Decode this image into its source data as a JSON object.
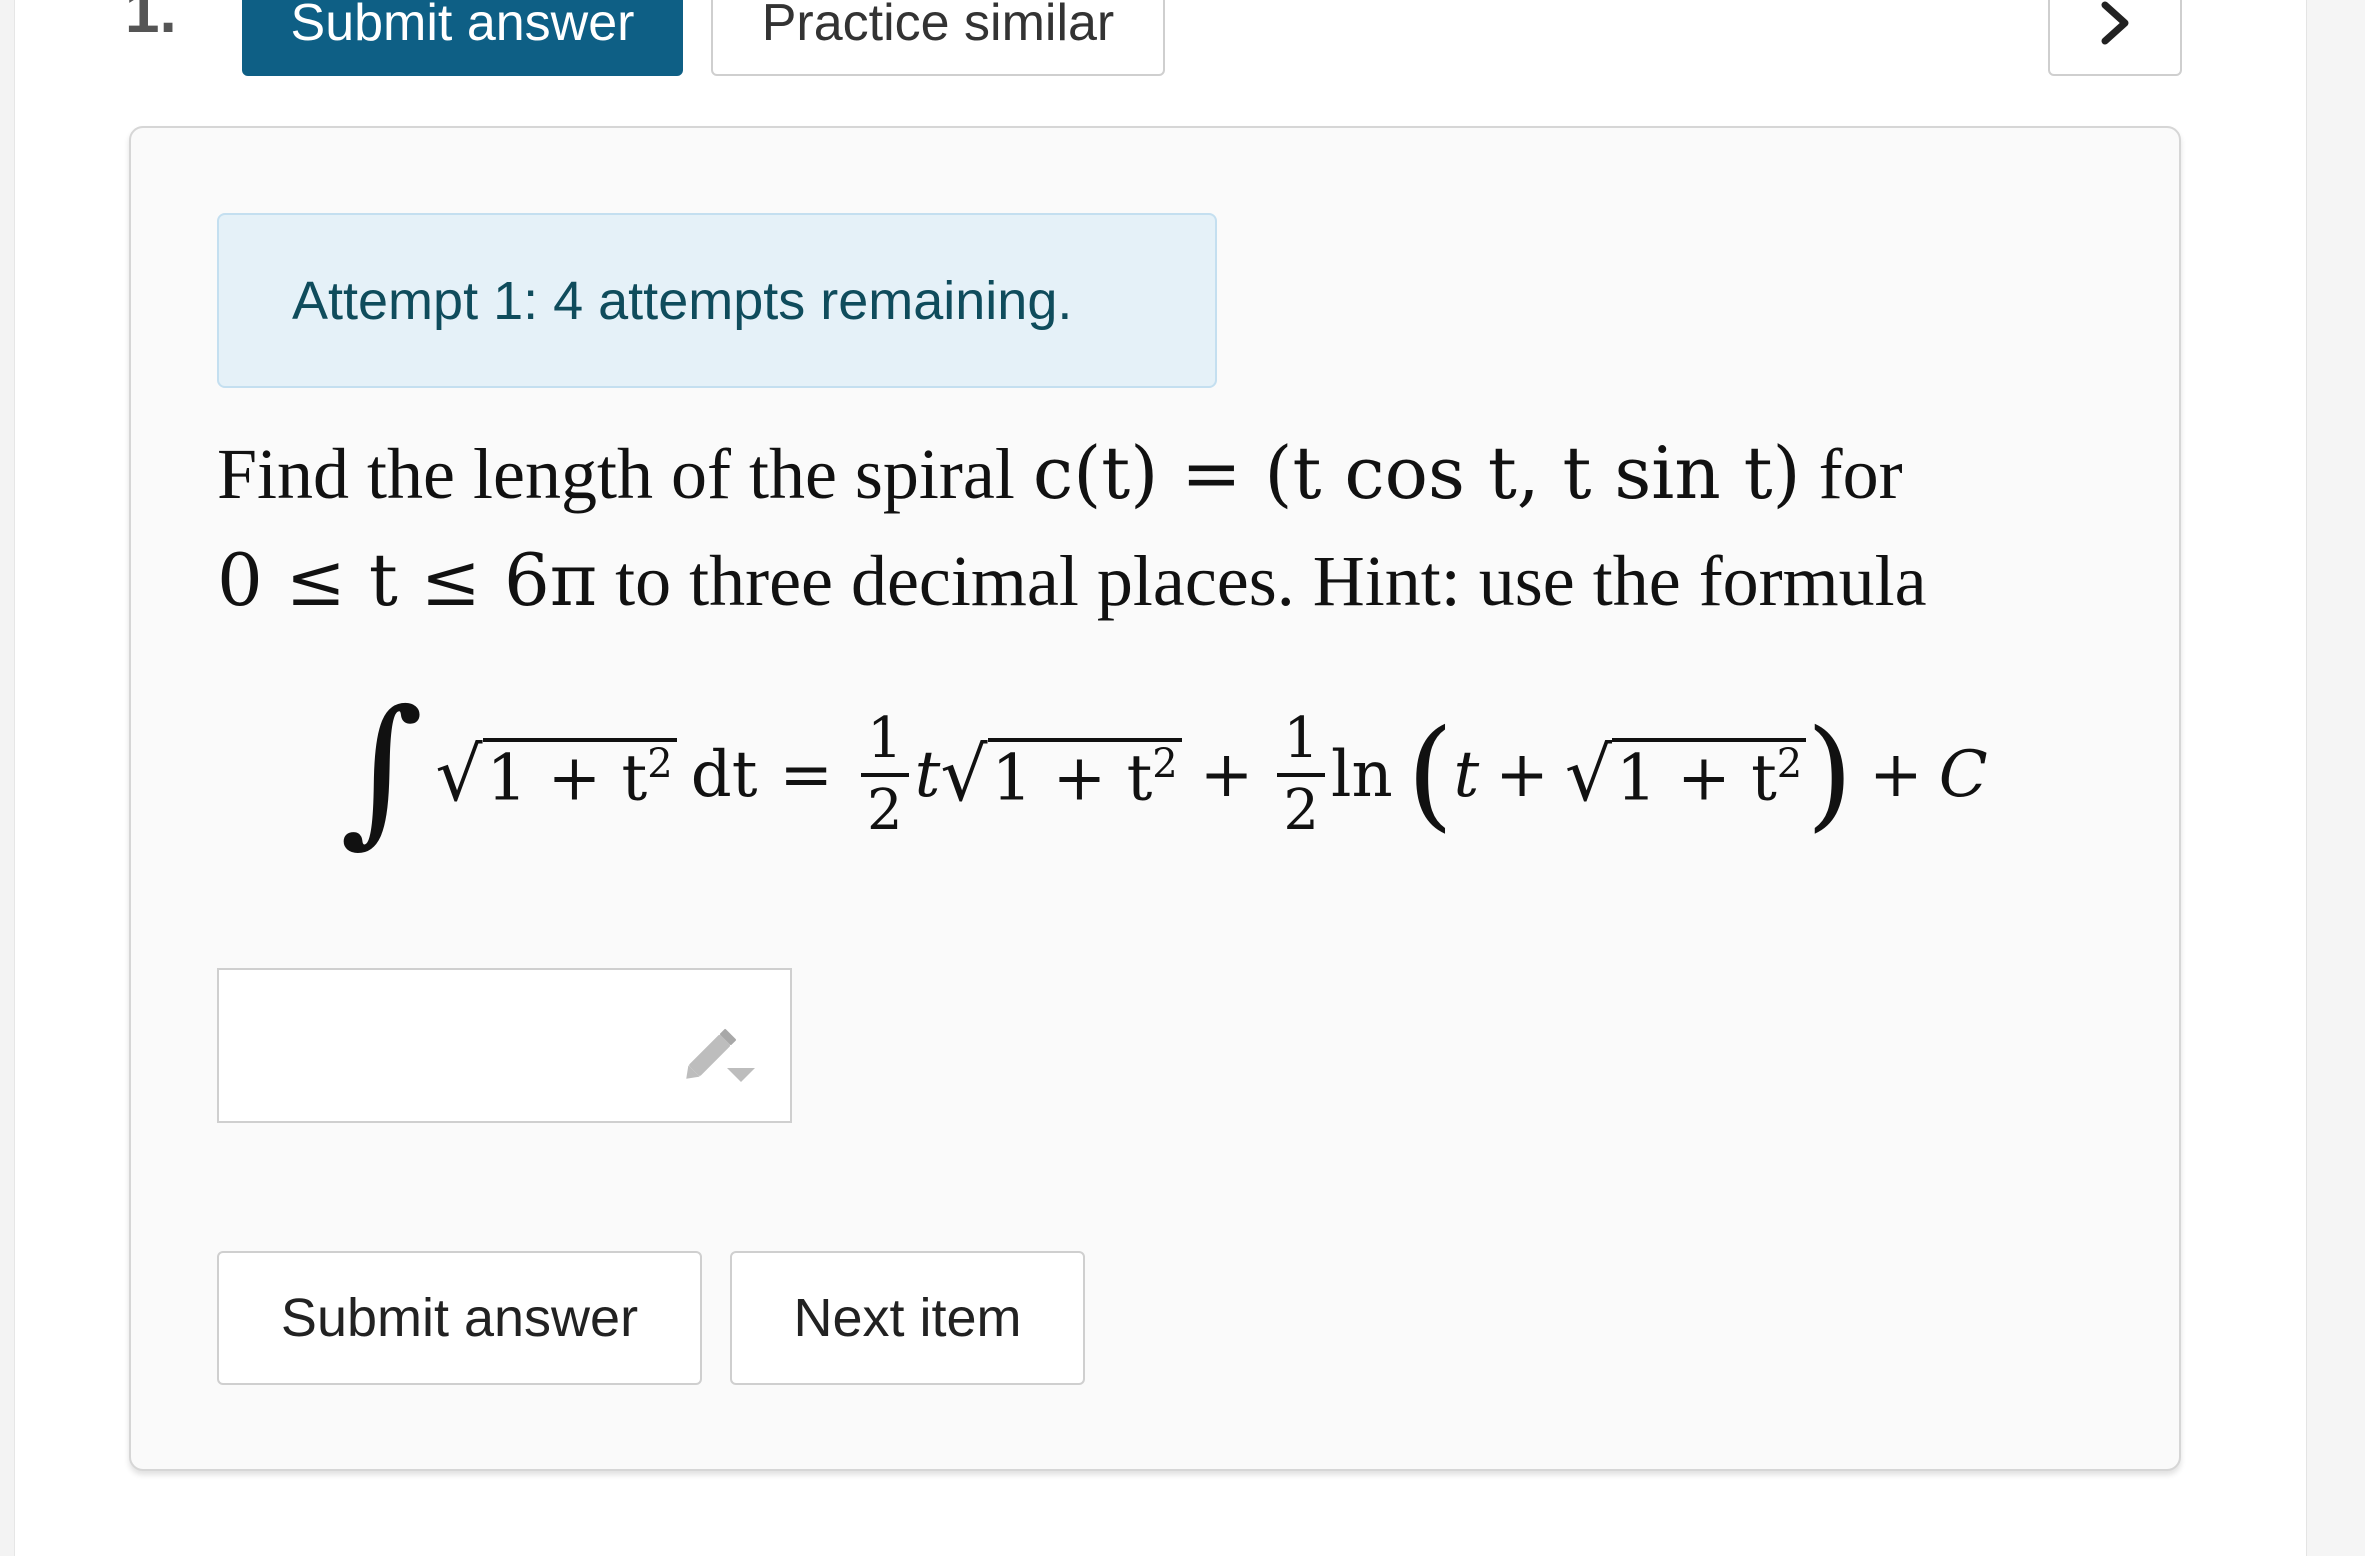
{
  "header": {
    "question_number": "1.",
    "submit_label": "Submit answer",
    "practice_label": "Practice similar",
    "next_icon": "chevron-right-icon"
  },
  "attempt": {
    "text": "Attempt 1: 4 attempts remaining."
  },
  "question": {
    "line1_prefix": "Find the length of the spiral ",
    "line1_math": "c(t) = (t cos t, t sin t)",
    "line1_suffix": " for",
    "line2_math": "0 ≤ t ≤ 6π",
    "line2_suffix": " to three decimal places. Hint: use the formula"
  },
  "formula": {
    "integral": "∫",
    "radicand": "1 + t",
    "exponent": "2",
    "dt": "dt",
    "equals": "=",
    "half_num": "1",
    "half_den": "2",
    "t": "t",
    "plus": "+",
    "ln": "ln",
    "open_paren": "(",
    "close_paren": ")",
    "constant": "C"
  },
  "answer": {
    "value": "",
    "placeholder": "",
    "icon": "pencil-icon"
  },
  "footer": {
    "submit_label": "Submit answer",
    "next_label": "Next item"
  },
  "colors": {
    "primary": "#0e5f85",
    "alert_bg": "#e5f1f8",
    "alert_text": "#0f4c5c"
  }
}
